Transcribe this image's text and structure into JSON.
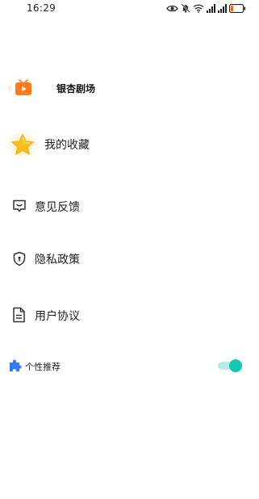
{
  "status_bar": {
    "time": "16:29",
    "icons": [
      "eye-icon",
      "mute-bell-icon",
      "wifi-icon",
      "signal-icon",
      "signal-icon",
      "battery-low-icon"
    ],
    "battery_color": "#ff6a00"
  },
  "menu": {
    "brand": {
      "label": "银杏剧场",
      "icon": "play-tv-icon",
      "icon_color": "#ff7a1a"
    },
    "favorites": {
      "label": "我的收藏",
      "icon": "star-icon",
      "icon_color": "#ffb400"
    },
    "feedback": {
      "label": "意见反馈",
      "icon": "message-box-icon"
    },
    "privacy": {
      "label": "隐私政策",
      "icon": "shield-icon"
    },
    "agreement": {
      "label": "用户协议",
      "icon": "document-icon"
    },
    "personalize": {
      "label": "个性推荐",
      "icon": "puzzle-icon",
      "icon_color": "#2f7cf6",
      "toggle_on": true,
      "toggle_color": "#14c8b0"
    }
  }
}
